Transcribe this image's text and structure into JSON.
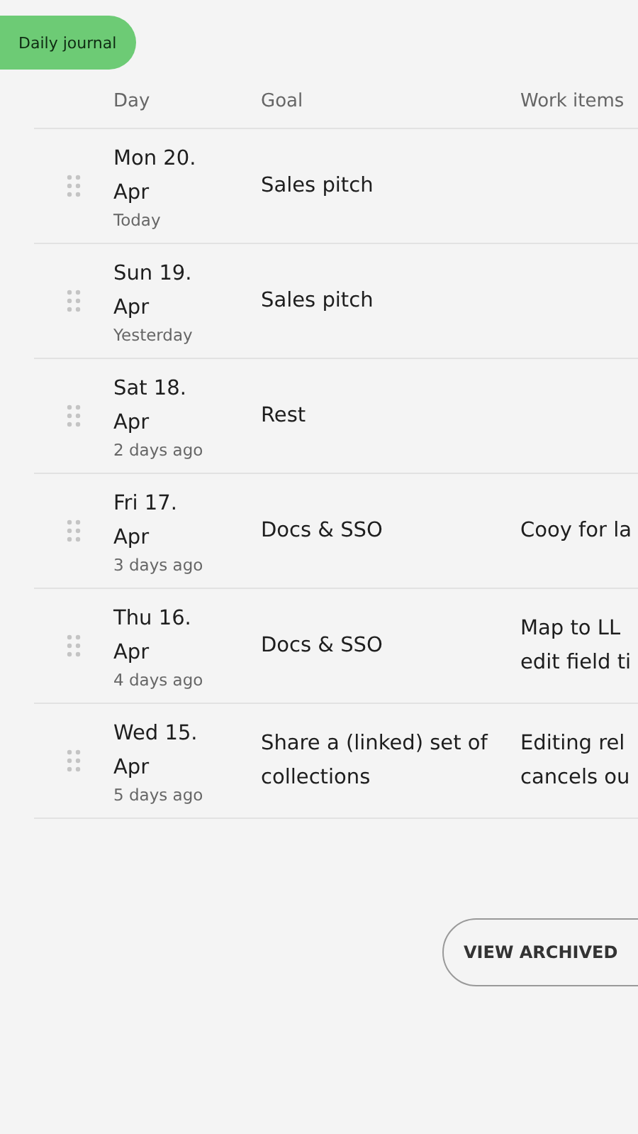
{
  "tab": {
    "label": "Daily journal"
  },
  "columns": [
    "Day",
    "Goal",
    "Work items"
  ],
  "rows": [
    {
      "day": "Mon 20.",
      "month": "Apr",
      "relative": "Today",
      "goal": "Sales pitch",
      "work_items": []
    },
    {
      "day": "Sun 19.",
      "month": "Apr",
      "relative": "Yesterday",
      "goal": "Sales pitch",
      "work_items": []
    },
    {
      "day": "Sat 18.",
      "month": "Apr",
      "relative": "2 days ago",
      "goal": "Rest",
      "work_items": []
    },
    {
      "day": "Fri 17.",
      "month": "Apr",
      "relative": "3 days ago",
      "goal": "Docs & SSO",
      "work_items": [
        "Cooy for la"
      ]
    },
    {
      "day": "Thu 16.",
      "month": "Apr",
      "relative": "4 days ago",
      "goal": "Docs & SSO",
      "work_items": [
        "Map to LL",
        "edit field ti"
      ]
    },
    {
      "day": "Wed 15.",
      "month": "Apr",
      "relative": "5 days ago",
      "goal": "Share a (linked) set of collections",
      "work_items": [
        "Editing rel",
        "cancels ou"
      ]
    }
  ],
  "archive_button": "VIEW ARCHIVED"
}
